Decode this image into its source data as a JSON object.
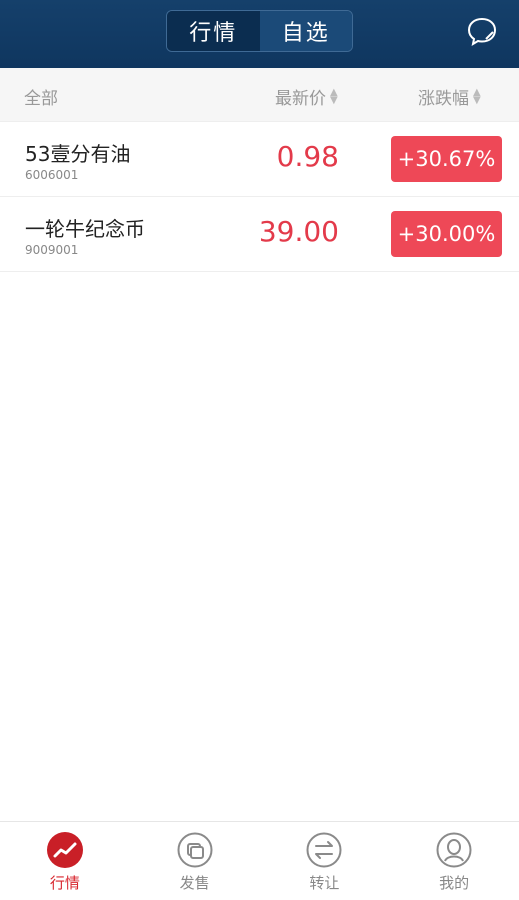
{
  "header": {
    "tabs": [
      {
        "label": "行情",
        "active": true
      },
      {
        "label": "自选",
        "active": false
      }
    ]
  },
  "columns": {
    "all": "全部",
    "price": "最新价",
    "change": "涨跌幅"
  },
  "rows": [
    {
      "name": "53壹分有油",
      "code": "6006001",
      "price": "0.98",
      "change": "+30.67%"
    },
    {
      "name": "一轮牛纪念币",
      "code": "9009001",
      "price": "39.00",
      "change": "+30.00%"
    }
  ],
  "tabbar": {
    "items": [
      {
        "label": "行情",
        "icon": "market-chart-icon",
        "active": true
      },
      {
        "label": "发售",
        "icon": "sale-icon",
        "active": false
      },
      {
        "label": "转让",
        "icon": "transfer-icon",
        "active": false
      },
      {
        "label": "我的",
        "icon": "profile-icon",
        "active": false
      }
    ]
  },
  "colors": {
    "header_bg": "#0f365f",
    "up_red": "#e33a4a",
    "badge_red": "#ee4857",
    "active_tab": "#d8262e"
  }
}
